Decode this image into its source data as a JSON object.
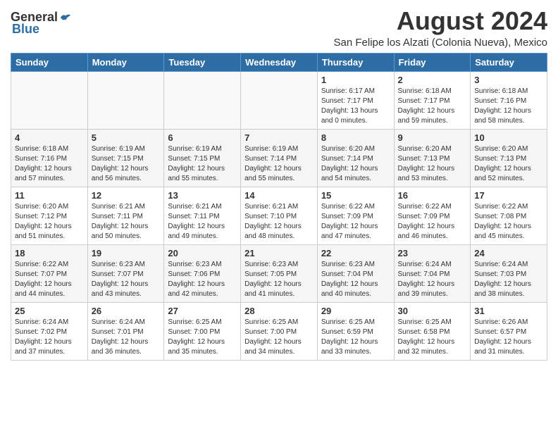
{
  "logo": {
    "general": "General",
    "blue": "Blue"
  },
  "header": {
    "month_title": "August 2024",
    "subtitle": "San Felipe los Alzati (Colonia Nueva), Mexico"
  },
  "weekdays": [
    "Sunday",
    "Monday",
    "Tuesday",
    "Wednesday",
    "Thursday",
    "Friday",
    "Saturday"
  ],
  "weeks": [
    [
      {
        "day": "",
        "sunrise": "",
        "sunset": "",
        "daylight": ""
      },
      {
        "day": "",
        "sunrise": "",
        "sunset": "",
        "daylight": ""
      },
      {
        "day": "",
        "sunrise": "",
        "sunset": "",
        "daylight": ""
      },
      {
        "day": "",
        "sunrise": "",
        "sunset": "",
        "daylight": ""
      },
      {
        "day": "1",
        "sunrise": "6:17 AM",
        "sunset": "7:17 PM",
        "daylight": "13 hours and 0 minutes."
      },
      {
        "day": "2",
        "sunrise": "6:18 AM",
        "sunset": "7:17 PM",
        "daylight": "12 hours and 59 minutes."
      },
      {
        "day": "3",
        "sunrise": "6:18 AM",
        "sunset": "7:16 PM",
        "daylight": "12 hours and 58 minutes."
      }
    ],
    [
      {
        "day": "4",
        "sunrise": "6:18 AM",
        "sunset": "7:16 PM",
        "daylight": "12 hours and 57 minutes."
      },
      {
        "day": "5",
        "sunrise": "6:19 AM",
        "sunset": "7:15 PM",
        "daylight": "12 hours and 56 minutes."
      },
      {
        "day": "6",
        "sunrise": "6:19 AM",
        "sunset": "7:15 PM",
        "daylight": "12 hours and 55 minutes."
      },
      {
        "day": "7",
        "sunrise": "6:19 AM",
        "sunset": "7:14 PM",
        "daylight": "12 hours and 55 minutes."
      },
      {
        "day": "8",
        "sunrise": "6:20 AM",
        "sunset": "7:14 PM",
        "daylight": "12 hours and 54 minutes."
      },
      {
        "day": "9",
        "sunrise": "6:20 AM",
        "sunset": "7:13 PM",
        "daylight": "12 hours and 53 minutes."
      },
      {
        "day": "10",
        "sunrise": "6:20 AM",
        "sunset": "7:13 PM",
        "daylight": "12 hours and 52 minutes."
      }
    ],
    [
      {
        "day": "11",
        "sunrise": "6:20 AM",
        "sunset": "7:12 PM",
        "daylight": "12 hours and 51 minutes."
      },
      {
        "day": "12",
        "sunrise": "6:21 AM",
        "sunset": "7:11 PM",
        "daylight": "12 hours and 50 minutes."
      },
      {
        "day": "13",
        "sunrise": "6:21 AM",
        "sunset": "7:11 PM",
        "daylight": "12 hours and 49 minutes."
      },
      {
        "day": "14",
        "sunrise": "6:21 AM",
        "sunset": "7:10 PM",
        "daylight": "12 hours and 48 minutes."
      },
      {
        "day": "15",
        "sunrise": "6:22 AM",
        "sunset": "7:09 PM",
        "daylight": "12 hours and 47 minutes."
      },
      {
        "day": "16",
        "sunrise": "6:22 AM",
        "sunset": "7:09 PM",
        "daylight": "12 hours and 46 minutes."
      },
      {
        "day": "17",
        "sunrise": "6:22 AM",
        "sunset": "7:08 PM",
        "daylight": "12 hours and 45 minutes."
      }
    ],
    [
      {
        "day": "18",
        "sunrise": "6:22 AM",
        "sunset": "7:07 PM",
        "daylight": "12 hours and 44 minutes."
      },
      {
        "day": "19",
        "sunrise": "6:23 AM",
        "sunset": "7:07 PM",
        "daylight": "12 hours and 43 minutes."
      },
      {
        "day": "20",
        "sunrise": "6:23 AM",
        "sunset": "7:06 PM",
        "daylight": "12 hours and 42 minutes."
      },
      {
        "day": "21",
        "sunrise": "6:23 AM",
        "sunset": "7:05 PM",
        "daylight": "12 hours and 41 minutes."
      },
      {
        "day": "22",
        "sunrise": "6:23 AM",
        "sunset": "7:04 PM",
        "daylight": "12 hours and 40 minutes."
      },
      {
        "day": "23",
        "sunrise": "6:24 AM",
        "sunset": "7:04 PM",
        "daylight": "12 hours and 39 minutes."
      },
      {
        "day": "24",
        "sunrise": "6:24 AM",
        "sunset": "7:03 PM",
        "daylight": "12 hours and 38 minutes."
      }
    ],
    [
      {
        "day": "25",
        "sunrise": "6:24 AM",
        "sunset": "7:02 PM",
        "daylight": "12 hours and 37 minutes."
      },
      {
        "day": "26",
        "sunrise": "6:24 AM",
        "sunset": "7:01 PM",
        "daylight": "12 hours and 36 minutes."
      },
      {
        "day": "27",
        "sunrise": "6:25 AM",
        "sunset": "7:00 PM",
        "daylight": "12 hours and 35 minutes."
      },
      {
        "day": "28",
        "sunrise": "6:25 AM",
        "sunset": "7:00 PM",
        "daylight": "12 hours and 34 minutes."
      },
      {
        "day": "29",
        "sunrise": "6:25 AM",
        "sunset": "6:59 PM",
        "daylight": "12 hours and 33 minutes."
      },
      {
        "day": "30",
        "sunrise": "6:25 AM",
        "sunset": "6:58 PM",
        "daylight": "12 hours and 32 minutes."
      },
      {
        "day": "31",
        "sunrise": "6:26 AM",
        "sunset": "6:57 PM",
        "daylight": "12 hours and 31 minutes."
      }
    ]
  ],
  "labels": {
    "sunrise_prefix": "Sunrise: ",
    "sunset_prefix": "Sunset: ",
    "daylight_prefix": "Daylight: "
  }
}
